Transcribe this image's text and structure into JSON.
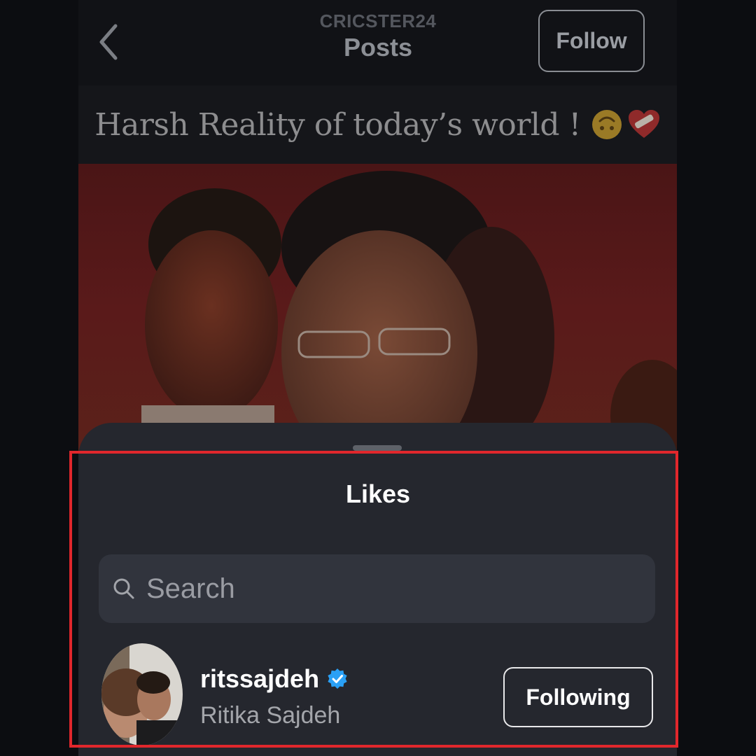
{
  "header": {
    "back_icon": "chevron-left-icon",
    "account_name": "CRICSTER24",
    "title": "Posts",
    "follow_label": "Follow"
  },
  "post": {
    "caption": "Harsh Reality of today’s world !",
    "caption_emojis": [
      "upside-down-face-emoji",
      "mending-heart-emoji"
    ],
    "image_background": "#5a1a1a"
  },
  "likes_sheet": {
    "title": "Likes",
    "search": {
      "placeholder": "Search",
      "value": "",
      "icon": "search-icon"
    },
    "users": [
      {
        "username": "ritssajdeh",
        "verified": true,
        "full_name": "Ritika Sajdeh",
        "button_label": "Following"
      }
    ]
  },
  "colors": {
    "background": "#0c0d11",
    "sheet": "#25272e",
    "search_field": "#31343d",
    "verified_blue": "#2aa0f5",
    "highlight_red": "#e1272c"
  }
}
